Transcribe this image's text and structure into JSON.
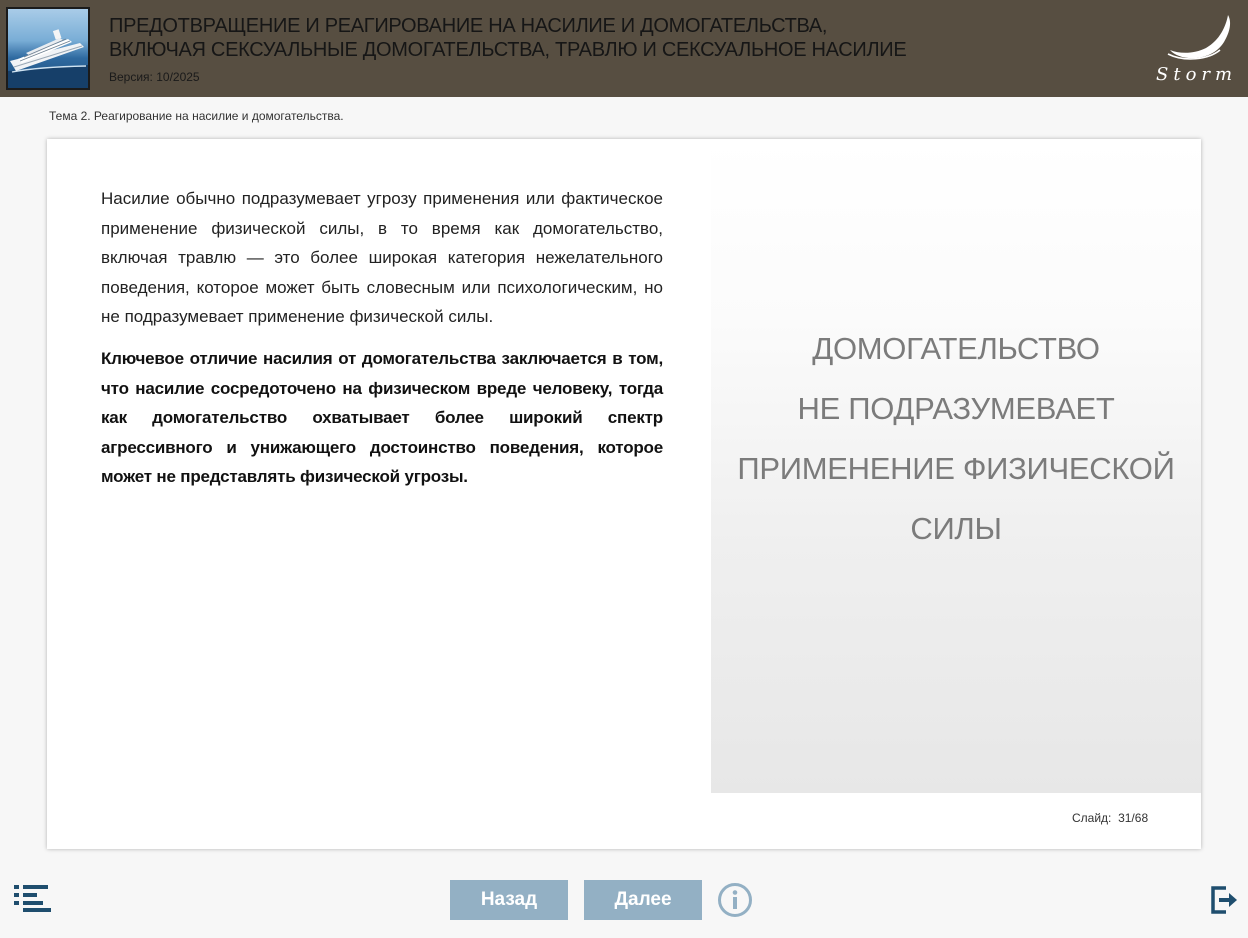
{
  "header": {
    "title_line1": "ПРЕДОТВРАЩЕНИЕ И РЕАГИРОВАНИЕ НА НАСИЛИЕ И ДОМОГАТЕЛЬСТВА,",
    "title_line2": "ВКЛЮЧАЯ СЕКСУАЛЬНЫЕ ДОМОГАТЕЛЬСТВА, ТРАВЛЮ И СЕКСУАЛЬНОЕ НАСИЛИЕ",
    "version": "Версия: 10/2025",
    "logo_icon": "storm-logo-icon",
    "thumbnail_icon": "cruise-ship-image",
    "colors": {
      "header_bg": "#574e41",
      "button_bg": "#93b0c4",
      "icon_color": "#1f4e6e"
    }
  },
  "topic": "Тема 2. Реагирование на насилие и домогательства.",
  "content": {
    "paragraph1": "Насилие обычно подразумевает угрозу применения или фактическое применение физической силы, в то время как домогательство, включая травлю — это более широкая категория нежелательного поведения, которое может быть словесным или психологическим, но не подразумевает применение физической силы.",
    "paragraph2": "Ключевое отличие насилия от домогательства заключается в том, что насилие сосредоточено на физическом вреде человеку, тогда как домогательство охватывает более широкий спектр агрессивного и унижающего достоинство поведения, которое может не представлять физической угрозы.",
    "panel_line1": "ДОМОГАТЕЛЬСТВО",
    "panel_line2": "НЕ ПОДРАЗУМЕВАЕТ",
    "panel_line3": "ПРИМЕНЕНИЕ ФИЗИЧЕСКОЙ",
    "panel_line4": "СИЛЫ"
  },
  "slide": {
    "label": "Слайд:",
    "current": "31",
    "total": "68"
  },
  "footer": {
    "menu_icon": "menu-list-icon",
    "back_label": "Назад",
    "next_label": "Далее",
    "info_icon": "info-icon",
    "exit_icon": "exit-icon"
  }
}
